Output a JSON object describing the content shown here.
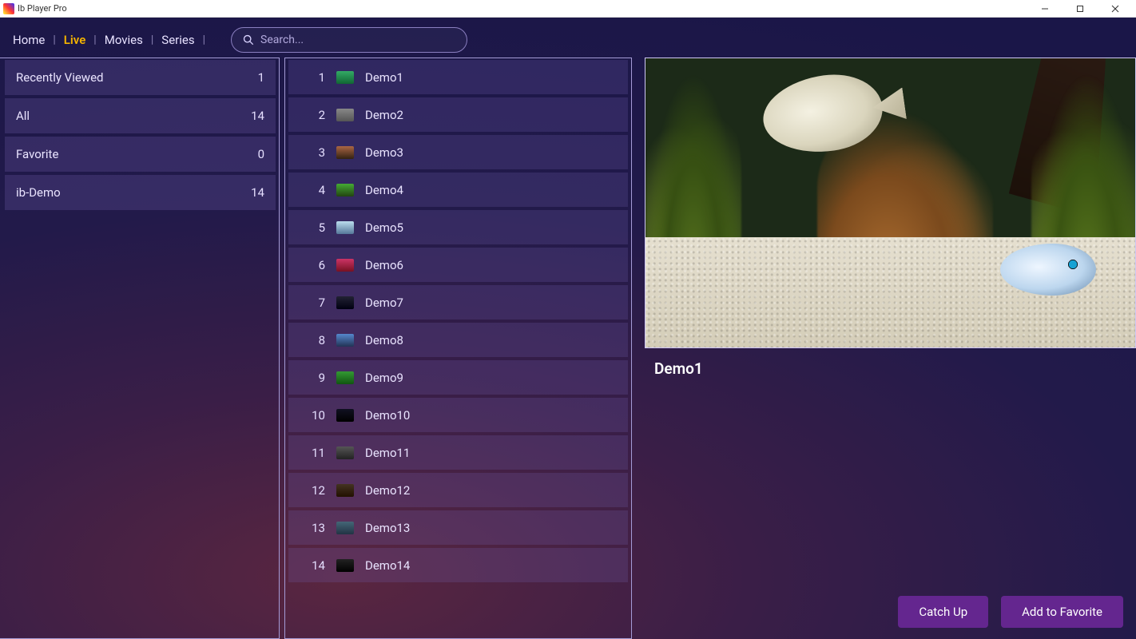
{
  "window": {
    "title": "Ib Player Pro"
  },
  "nav": {
    "items": [
      {
        "label": "Home",
        "active": false
      },
      {
        "label": "Live",
        "active": true
      },
      {
        "label": "Movies",
        "active": false
      },
      {
        "label": "Series",
        "active": false
      }
    ],
    "search_placeholder": "Search..."
  },
  "categories": [
    {
      "label": "Recently Viewed",
      "count": "1"
    },
    {
      "label": "All",
      "count": "14"
    },
    {
      "label": "Favorite",
      "count": "0"
    },
    {
      "label": "ib-Demo",
      "count": "14"
    }
  ],
  "channels": [
    {
      "num": "1",
      "name": "Demo1"
    },
    {
      "num": "2",
      "name": "Demo2"
    },
    {
      "num": "3",
      "name": "Demo3"
    },
    {
      "num": "4",
      "name": "Demo4"
    },
    {
      "num": "5",
      "name": "Demo5"
    },
    {
      "num": "6",
      "name": "Demo6"
    },
    {
      "num": "7",
      "name": "Demo7"
    },
    {
      "num": "8",
      "name": "Demo8"
    },
    {
      "num": "9",
      "name": "Demo9"
    },
    {
      "num": "10",
      "name": "Demo10"
    },
    {
      "num": "11",
      "name": "Demo11"
    },
    {
      "num": "12",
      "name": "Demo12"
    },
    {
      "num": "13",
      "name": "Demo13"
    },
    {
      "num": "14",
      "name": "Demo14"
    }
  ],
  "preview": {
    "title": "Demo1",
    "catchup_label": "Catch Up",
    "favorite_label": "Add to Favorite"
  }
}
